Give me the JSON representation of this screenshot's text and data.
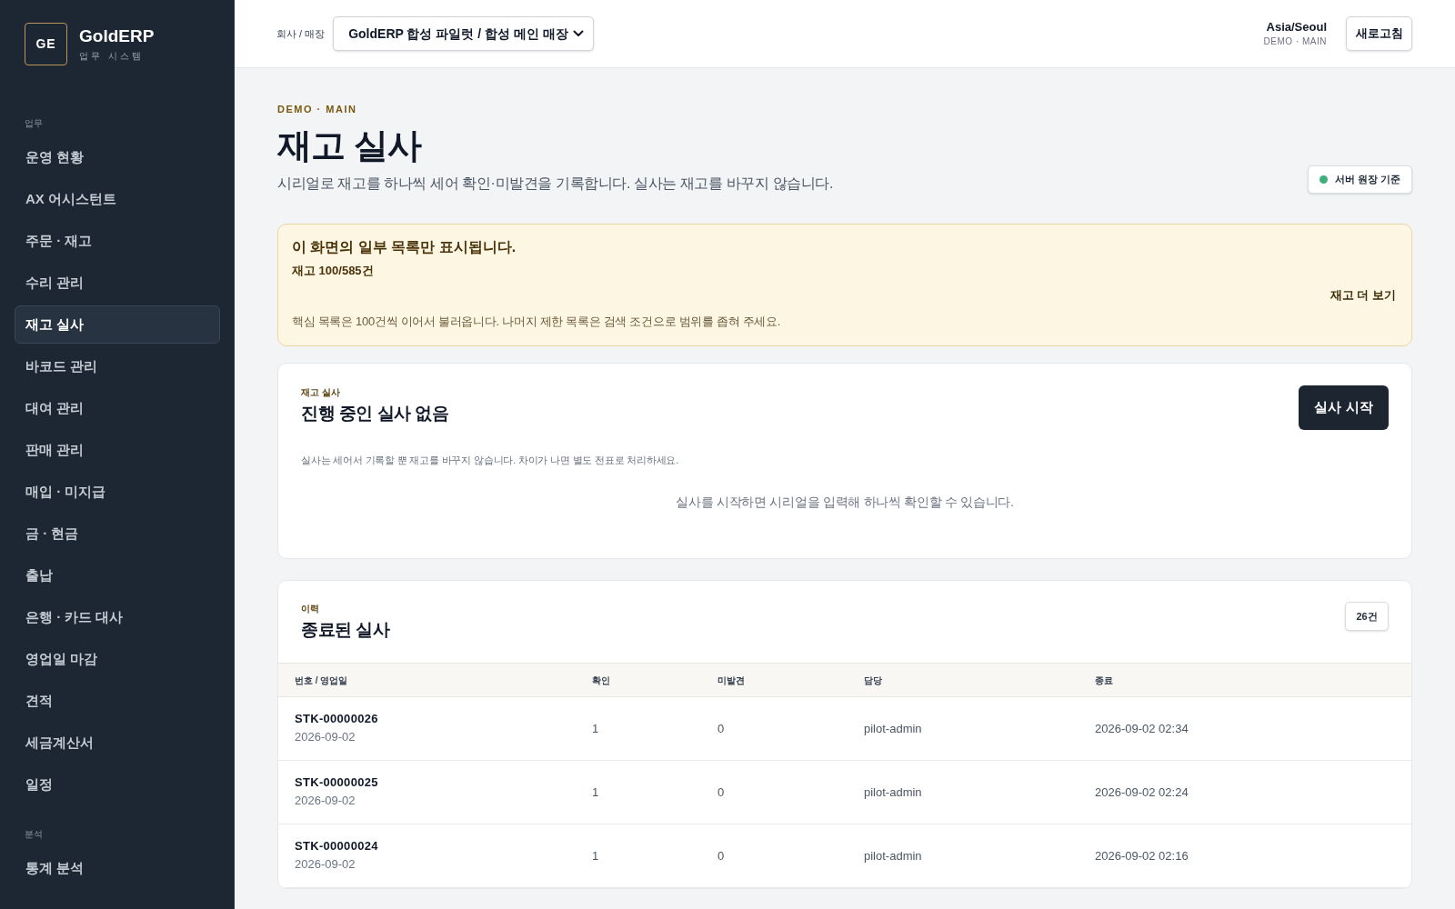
{
  "sidebar": {
    "logo": {
      "initials": "GE",
      "title": "GoldERP",
      "subtitle": "업무 시스템"
    },
    "sections": [
      {
        "label": "업무",
        "items": [
          {
            "label": "운영 현황",
            "selected": false
          },
          {
            "label": "AX 어시스턴트",
            "selected": false
          },
          {
            "label": "주문 · 재고",
            "selected": false
          },
          {
            "label": "수리 관리",
            "selected": false
          },
          {
            "label": "재고 실사",
            "selected": true
          },
          {
            "label": "바코드 관리",
            "selected": false
          },
          {
            "label": "대여 관리",
            "selected": false
          },
          {
            "label": "판매 관리",
            "selected": false
          },
          {
            "label": "매입 · 미지급",
            "selected": false
          },
          {
            "label": "금 · 현금",
            "selected": false
          },
          {
            "label": "출납",
            "selected": false
          },
          {
            "label": "은행 · 카드 대사",
            "selected": false
          },
          {
            "label": "영업일 마감",
            "selected": false
          },
          {
            "label": "견적",
            "selected": false
          },
          {
            "label": "세금계산서",
            "selected": false
          },
          {
            "label": "일정",
            "selected": false
          }
        ]
      },
      {
        "label": "분석",
        "items": [
          {
            "label": "통계 분석",
            "selected": false
          }
        ]
      }
    ]
  },
  "header": {
    "store_label": "회사 / 매장",
    "store_select": {
      "value": "GoldERP 합성 파일럿 / 합성 메인 매장"
    },
    "timezone": "Asia/Seoul",
    "environment": "DEMO · MAIN",
    "refresh_button": "새로고침"
  },
  "page": {
    "eyebrow": "DEMO · MAIN",
    "title": "재고 실사",
    "description": "시리얼로 재고를 하나씩 세어 확인·미발견을 기록합니다. 실사는 재고를 바꾸지 않습니다.",
    "source_badge": "서버 원장 기준"
  },
  "notice": {
    "title": "이 화면의 일부 목록만 표시됩니다.",
    "count": "재고 100/585건",
    "link": "재고 더 보기",
    "text": "핵심 목록은 100건씩 이어서 불러옵니다. 나머지 제한 목록은 검색 조건으로 범위를 좁혀 주세요."
  },
  "active_session": {
    "eyebrow": "재고 실사",
    "title": "진행 중인 실사 없음",
    "start_button": "실사 시작",
    "note": "실사는 세어서 기록할 뿐 재고를 바꾸지 않습니다. 차이가 나면 별도 전표로 처리하세요.",
    "empty_message": "실사를 시작하면 시리얼을 입력해 하나씩 확인할 수 있습니다."
  },
  "history": {
    "eyebrow": "이력",
    "title": "종료된 실사",
    "count": "26건",
    "table": {
      "columns": [
        "번호 / 영업일",
        "확인",
        "미발견",
        "담당",
        "종료"
      ],
      "rows": [
        {
          "number": "STK-00000026",
          "business_date": "2026-09-02",
          "confirmed": "1",
          "missing": "0",
          "assignee": "pilot-admin",
          "closed": "2026-09-02 02:34"
        },
        {
          "number": "STK-00000025",
          "business_date": "2026-09-02",
          "confirmed": "1",
          "missing": "0",
          "assignee": "pilot-admin",
          "closed": "2026-09-02 02:24"
        },
        {
          "number": "STK-00000024",
          "business_date": "2026-09-02",
          "confirmed": "1",
          "missing": "0",
          "assignee": "pilot-admin",
          "closed": "2026-09-02 02:16"
        }
      ]
    }
  }
}
